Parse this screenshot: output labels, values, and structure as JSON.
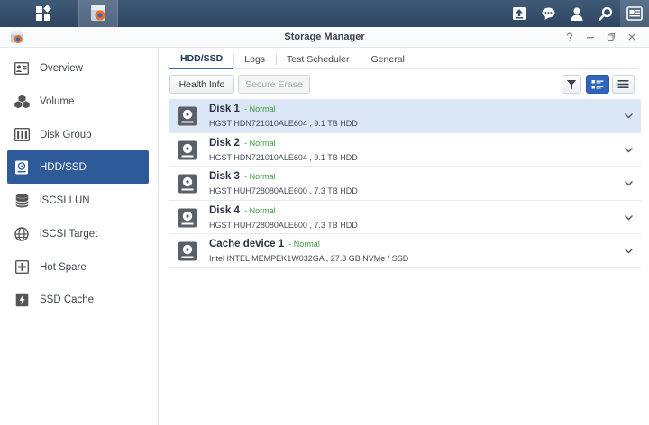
{
  "window": {
    "title": "Storage Manager"
  },
  "taskbar": {
    "main_icon": "grid-icon",
    "app_icon": "storage-manager-icon",
    "right_icons": [
      "upload-icon",
      "chat-icon",
      "user-icon",
      "search-icon",
      "widgets-icon"
    ]
  },
  "sidebar": {
    "items": [
      {
        "label": "Overview",
        "icon": "overview-icon"
      },
      {
        "label": "Volume",
        "icon": "volume-icon"
      },
      {
        "label": "Disk Group",
        "icon": "disk-group-icon"
      },
      {
        "label": "HDD/SSD",
        "icon": "hdd-icon",
        "active": true
      },
      {
        "label": "iSCSI LUN",
        "icon": "lun-icon"
      },
      {
        "label": "iSCSI Target",
        "icon": "globe-icon"
      },
      {
        "label": "Hot Spare",
        "icon": "hot-spare-icon"
      },
      {
        "label": "SSD Cache",
        "icon": "ssd-cache-icon"
      }
    ]
  },
  "tabs": [
    "HDD/SSD",
    "Logs",
    "Test Scheduler",
    "General"
  ],
  "toolbar": {
    "health_info": "Health Info",
    "secure_erase": "Secure Erase"
  },
  "disks": [
    {
      "name": "Disk 1",
      "status": "- Normal",
      "desc": "HGST HDN721010ALE604 , 9.1 TB HDD",
      "selected": true
    },
    {
      "name": "Disk 2",
      "status": "- Normal",
      "desc": "HGST HDN721010ALE604 , 9.1 TB HDD"
    },
    {
      "name": "Disk 3",
      "status": "- Normal",
      "desc": "HGST HUH728080ALE600 , 7.3 TB HDD"
    },
    {
      "name": "Disk 4",
      "status": "- Normal",
      "desc": "HGST HUH728080ALE600 , 7.3 TB HDD"
    },
    {
      "name": "Cache device 1",
      "status": "- Normal",
      "desc": "Intel INTEL MEMPEK1W032GA , 27.3 GB NVMe / SSD"
    }
  ],
  "colors": {
    "accent": "#2f5a99",
    "status_normal": "#3b9a3b",
    "taskbar": "#34506e"
  }
}
